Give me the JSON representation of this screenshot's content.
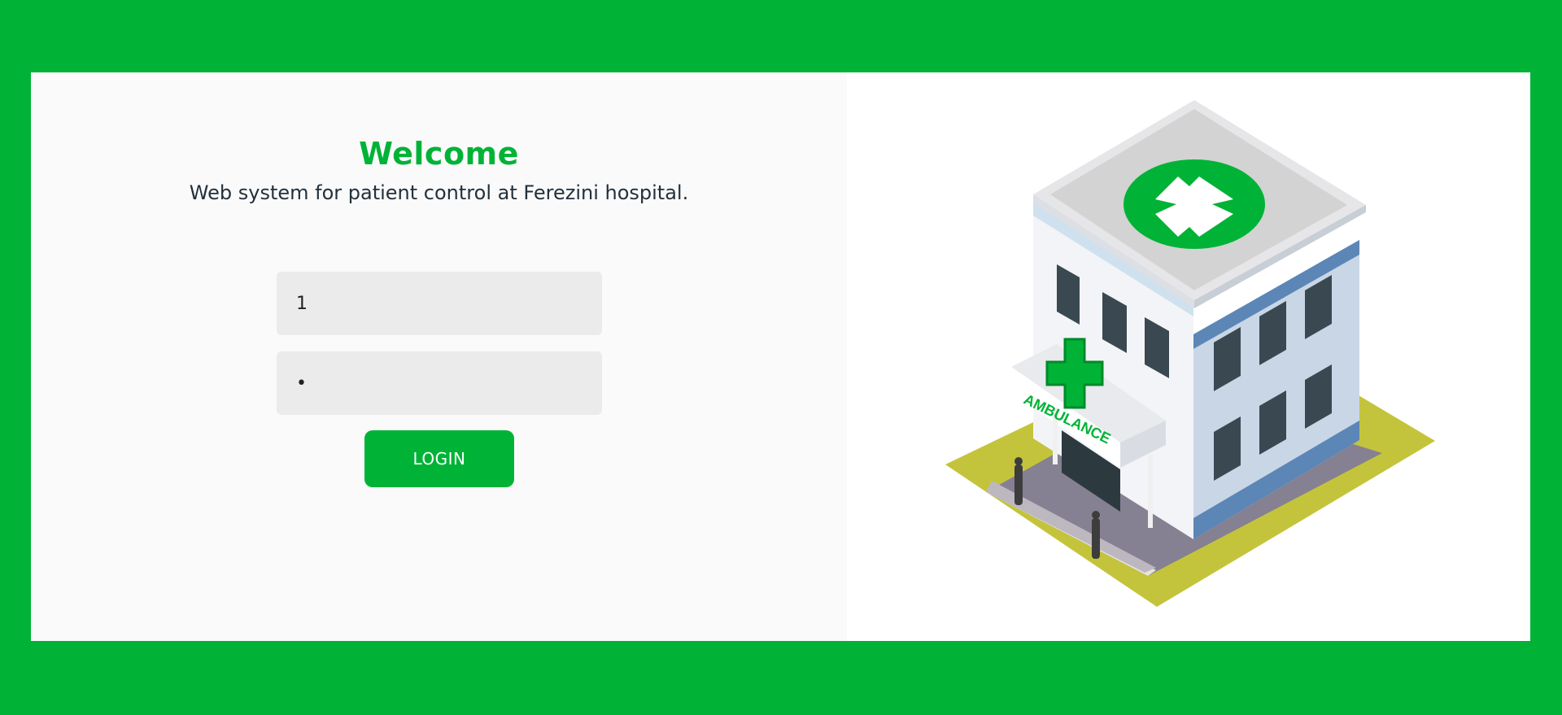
{
  "login": {
    "title": "Welcome",
    "subtitle": "Web system for patient control at Ferezini hospital.",
    "username_value": "1",
    "password_value": "1",
    "login_label": "LOGIN"
  },
  "illustration": {
    "sign_text": "AMBULANCE",
    "icon": "hospital-building-illustration"
  },
  "colors": {
    "brand": "#00b336",
    "text": "#23313d"
  }
}
